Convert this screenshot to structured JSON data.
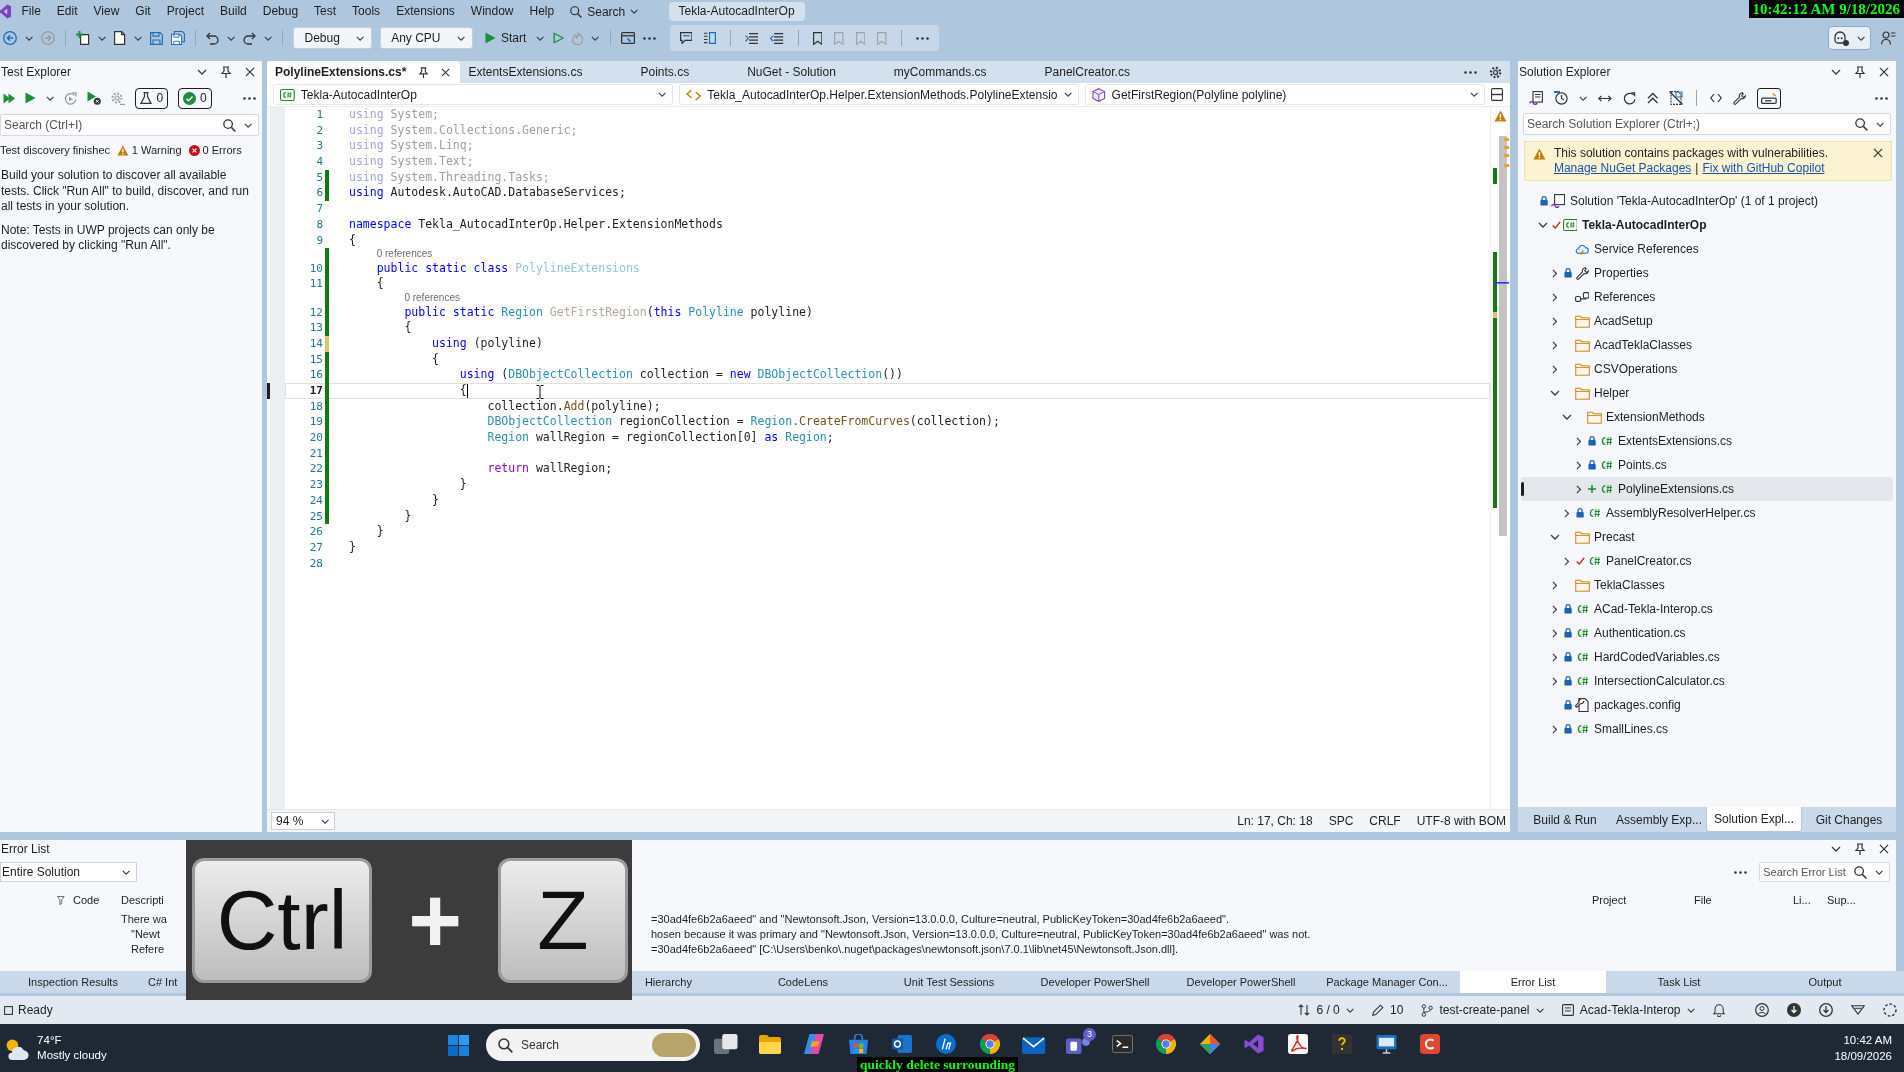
{
  "menu_bar": {
    "items": [
      "File",
      "Edit",
      "View",
      "Git",
      "Project",
      "Build",
      "Debug",
      "Test",
      "Tools",
      "Extensions",
      "Window",
      "Help"
    ],
    "search": "Search",
    "title": "Tekla-AutocadInterOp"
  },
  "clock_overlay": "10:42:12 AM 9/18/2026",
  "toolbar": {
    "configuration": "Debug",
    "platform": "Any CPU",
    "start": "Start"
  },
  "test_explorer": {
    "title": "Test Explorer",
    "test_count": "0",
    "passed_count": "0",
    "search": {
      "placeholder": "Search (Ctrl+I)"
    },
    "status": "Test discovery finishec",
    "warnings": "1 Warning",
    "errors": "0 Errors",
    "messages": [
      "Build your solution to discover all available tests. Click \"Run All\" to build, discover, and run all tests in your solution.",
      "Note: Tests in UWP projects can only be discovered by clicking \"Run All\"."
    ]
  },
  "editor": {
    "tabs": [
      {
        "label": "PolylineExtensions.cs*",
        "selected": true
      },
      {
        "label": "ExtentsExtensions.cs",
        "selected": false
      },
      {
        "label": "Points.cs",
        "selected": false
      },
      {
        "label": "NuGet - Solution",
        "selected": false
      },
      {
        "label": "myCommands.cs",
        "selected": false
      },
      {
        "label": "PanelCreator.cs",
        "selected": false
      }
    ],
    "nav": {
      "project": "Tekla-AutocadInterOp",
      "type": "Tekla_AutocadInterOp.Helper.ExtensionMethods.PolylineExtensio",
      "member": "GetFirstRegion(Polyline polyline)"
    },
    "lines": [
      {
        "number": "1",
        "current": false,
        "tokens": [
          {
            "text": "using",
            "kind": "faded-keyword"
          },
          {
            "text": " System;",
            "kind": "faded"
          }
        ]
      },
      {
        "number": "2",
        "current": false,
        "tokens": [
          {
            "text": "using",
            "kind": "faded-keyword"
          },
          {
            "text": " System.Collections.Generic;",
            "kind": "faded"
          }
        ]
      },
      {
        "number": "3",
        "current": false,
        "tokens": [
          {
            "text": "using",
            "kind": "faded-keyword"
          },
          {
            "text": " System.Linq;",
            "kind": "faded"
          }
        ]
      },
      {
        "number": "4",
        "current": false,
        "tokens": [
          {
            "text": "using",
            "kind": "faded-keyword"
          },
          {
            "text": " System.Text;",
            "kind": "faded"
          }
        ]
      },
      {
        "number": "5",
        "current": false,
        "changed": true,
        "saved": true,
        "tokens": [
          {
            "text": "using",
            "kind": "faded-keyword"
          },
          {
            "text": " System.Threading.Tasks;",
            "kind": "faded"
          }
        ]
      },
      {
        "number": "6",
        "current": false,
        "changed": true,
        "saved": true,
        "tokens": [
          {
            "text": "using",
            "kind": "keyword"
          },
          {
            "text": " Autodesk.AutoCAD.DatabaseServices;",
            "kind": "plain"
          }
        ]
      },
      {
        "number": "7",
        "current": false
      },
      {
        "number": "8",
        "current": false,
        "tokens": [
          {
            "text": "namespace",
            "kind": "keyword"
          },
          {
            "text": " Tekla_AutocadInterOp.Helper.ExtensionMethods",
            "kind": "plain"
          }
        ]
      },
      {
        "number": "9",
        "current": false,
        "tokens": [
          {
            "text": "{",
            "kind": "plain"
          }
        ],
        "children": [
          {
            "number": "10",
            "current": false,
            "changed": true,
            "saved": true,
            "codelens": "0 references",
            "tokens": [
              {
                "text": "public static class ",
                "kind": "keyword"
              },
              {
                "text": "PolylineExtensions",
                "kind": "faded-type"
              }
            ]
          },
          {
            "number": "11",
            "current": false,
            "changed": true,
            "saved": true,
            "tokens": [
              {
                "text": "{",
                "kind": "plain"
              }
            ],
            "children": [
              {
                "number": "12",
                "current": false,
                "changed": true,
                "saved": true,
                "codelens": "0 references",
                "tokens": [
                  {
                    "text": "public static ",
                    "kind": "keyword"
                  },
                  {
                    "text": "Region ",
                    "kind": "type"
                  },
                  {
                    "text": "GetFirstRegion",
                    "kind": "faded-method"
                  },
                  {
                    "text": "(",
                    "kind": "plain"
                  },
                  {
                    "text": "this ",
                    "kind": "keyword"
                  },
                  {
                    "text": "Polyline",
                    "kind": "type"
                  },
                  {
                    "text": " polyline)",
                    "kind": "plain"
                  }
                ]
              },
              {
                "number": "13",
                "current": false,
                "changed": true,
                "saved": true,
                "tokens": [
                  {
                    "text": "{",
                    "kind": "plain"
                  }
                ],
                "children": [
                  {
                    "number": "14",
                    "current": false,
                    "changed": true,
                    "saved": false,
                    "tokens": [
                      {
                        "text": "using",
                        "kind": "keyword"
                      },
                      {
                        "text": " (polyline)",
                        "kind": "plain"
                      }
                    ]
                  },
                  {
                    "number": "15",
                    "current": false,
                    "changed": true,
                    "saved": true,
                    "tokens": [
                      {
                        "text": "{",
                        "kind": "plain"
                      }
                    ],
                    "children": [
                      {
                        "number": "16",
                        "current": false,
                        "changed": true,
                        "saved": true,
                        "tokens": [
                          {
                            "text": "using",
                            "kind": "keyword"
                          },
                          {
                            "text": " (",
                            "kind": "plain"
                          },
                          {
                            "text": "DBObjectCollection",
                            "kind": "type"
                          },
                          {
                            "text": " collection = ",
                            "kind": "plain"
                          },
                          {
                            "text": "new ",
                            "kind": "keyword"
                          },
                          {
                            "text": "DBObjectCollection",
                            "kind": "type"
                          },
                          {
                            "text": "())",
                            "kind": "plain"
                          }
                        ]
                      },
                      {
                        "number": "17",
                        "current": true,
                        "changed": true,
                        "saved": true,
                        "tokens": [
                          {
                            "text": "{",
                            "kind": "plain"
                          }
                        ],
                        "children": [
                          {
                            "number": "18",
                            "current": false,
                            "changed": true,
                            "saved": true,
                            "tokens": [
                              {
                                "text": "collection.",
                                "kind": "plain"
                              },
                              {
                                "text": "Add",
                                "kind": "method"
                              },
                              {
                                "text": "(polyline);",
                                "kind": "plain"
                              }
                            ]
                          },
                          {
                            "number": "19",
                            "current": false,
                            "changed": true,
                            "saved": true,
                            "tokens": [
                              {
                                "text": "DBObjectCollection",
                                "kind": "type"
                              },
                              {
                                "text": " regionCollection = ",
                                "kind": "plain"
                              },
                              {
                                "text": "Region",
                                "kind": "type"
                              },
                              {
                                "text": ".CreateFromCurves",
                                "kind": "method"
                              },
                              {
                                "text": "(collection);",
                                "kind": "plain"
                              }
                            ]
                          },
                          {
                            "number": "20",
                            "current": false,
                            "changed": true,
                            "saved": true,
                            "tokens": [
                              {
                                "text": "Region",
                                "kind": "type"
                              },
                              {
                                "text": " wallRegion = regionCollection[0] ",
                                "kind": "plain"
                              },
                              {
                                "text": "as ",
                                "kind": "keyword"
                              },
                              {
                                "text": "Region",
                                "kind": "type"
                              },
                              {
                                "text": ";",
                                "kind": "plain"
                              }
                            ]
                          },
                          {
                            "number": "21",
                            "current": false,
                            "changed": true,
                            "saved": true
                          },
                          {
                            "number": "22",
                            "current": false,
                            "changed": true,
                            "saved": true,
                            "tokens": [
                              {
                                "text": "return",
                                "kind": "control-keyword"
                              },
                              {
                                "text": " wallRegion;",
                                "kind": "plain"
                              }
                            ]
                          }
                        ]
                      },
                      {
                        "number": "23",
                        "current": false,
                        "changed": true,
                        "saved": true,
                        "tokens": [
                          {
                            "text": "}",
                            "kind": "plain"
                          }
                        ]
                      }
                    ]
                  },
                  {
                    "number": "24",
                    "current": false,
                    "changed": true,
                    "saved": true,
                    "tokens": [
                      {
                        "text": "}",
                        "kind": "plain"
                      }
                    ]
                  }
                ]
              },
              {
                "number": "25",
                "current": false,
                "changed": true,
                "saved": true,
                "tokens": [
                  {
                    "text": "}",
                    "kind": "plain"
                  }
                ]
              }
            ]
          },
          {
            "number": "26",
            "current": false,
            "tokens": [
              {
                "text": "}",
                "kind": "plain"
              }
            ]
          }
        ]
      },
      {
        "number": "27",
        "current": false,
        "tokens": [
          {
            "text": "}",
            "kind": "plain"
          }
        ]
      },
      {
        "number": "28",
        "current": false
      }
    ],
    "zoom": "94 %",
    "position": "Ln: 17, Ch: 18",
    "indentation": "SPC",
    "line_ending": "CRLF",
    "encoding": "UTF-8 with BOM"
  },
  "solution_explorer": {
    "title": "Solution Explorer",
    "toolbar_toggle": {
      "on": true
    },
    "search": {
      "placeholder": "Search Solution Explorer (Ctrl+;)"
    },
    "infobar": {
      "message": "This solution contains packages with vulnerabilities.",
      "links": [
        "Manage NuGet Packages",
        "Fix with GitHub Copilot"
      ],
      "separator": "|"
    },
    "tree": [
      {
        "label": "Solution 'Tekla-AutocadInterOp' (1 of 1 project)",
        "kind": "solution",
        "locked": true,
        "added": false,
        "modified": false,
        "selected": false,
        "children": [
          {
            "label": "Tekla-AutocadInterOp",
            "kind": "project",
            "locked": false,
            "added": false,
            "modified": true,
            "expanded": true,
            "selected": false,
            "children": [
              {
                "label": "Service References",
                "kind": "service-references",
                "locked": false,
                "added": false,
                "modified": false,
                "selected": false
              },
              {
                "label": "Properties",
                "kind": "properties",
                "locked": true,
                "added": false,
                "modified": false,
                "expanded": false,
                "selected": false
              },
              {
                "label": "References",
                "kind": "references",
                "locked": false,
                "added": false,
                "modified": false,
                "expanded": false,
                "selected": false
              },
              {
                "label": "AcadSetup",
                "kind": "folder",
                "locked": false,
                "added": false,
                "modified": false,
                "expanded": false,
                "selected": false
              },
              {
                "label": "AcadTeklaClasses",
                "kind": "folder",
                "locked": false,
                "added": false,
                "modified": false,
                "expanded": false,
                "selected": false
              },
              {
                "label": "CSVOperations",
                "kind": "folder",
                "locked": false,
                "added": false,
                "modified": false,
                "expanded": false,
                "selected": false
              },
              {
                "label": "Helper",
                "kind": "folder",
                "locked": false,
                "added": false,
                "modified": false,
                "expanded": true,
                "selected": false,
                "children": [
                  {
                    "label": "ExtensionMethods",
                    "kind": "folder",
                    "locked": false,
                    "added": false,
                    "modified": false,
                    "expanded": true,
                    "selected": false,
                    "children": [
                      {
                        "label": "ExtentsExtensions.cs",
                        "kind": "csharp",
                        "locked": true,
                        "added": false,
                        "modified": false,
                        "expanded": false,
                        "selected": false
                      },
                      {
                        "label": "Points.cs",
                        "kind": "csharp",
                        "locked": true,
                        "added": false,
                        "modified": false,
                        "expanded": false,
                        "selected": false
                      },
                      {
                        "label": "PolylineExtensions.cs",
                        "kind": "csharp",
                        "locked": false,
                        "added": true,
                        "modified": false,
                        "expanded": false,
                        "selected": true
                      }
                    ]
                  },
                  {
                    "label": "AssemblyResolverHelper.cs",
                    "kind": "csharp",
                    "locked": true,
                    "added": false,
                    "modified": false,
                    "expanded": false,
                    "selected": false
                  }
                ]
              },
              {
                "label": "Precast",
                "kind": "folder",
                "locked": false,
                "added": false,
                "modified": false,
                "expanded": true,
                "selected": false,
                "children": [
                  {
                    "label": "PanelCreator.cs",
                    "kind": "csharp",
                    "locked": false,
                    "added": false,
                    "modified": true,
                    "expanded": false,
                    "selected": false
                  }
                ]
              },
              {
                "label": "TeklaClasses",
                "kind": "folder",
                "locked": false,
                "added": false,
                "modified": false,
                "expanded": false,
                "selected": false
              },
              {
                "label": "ACad-Tekla-Interop.cs",
                "kind": "csharp",
                "locked": true,
                "added": false,
                "modified": false,
                "expanded": false,
                "selected": false
              },
              {
                "label": "Authentication.cs",
                "kind": "csharp",
                "locked": true,
                "added": false,
                "modified": false,
                "expanded": false,
                "selected": false
              },
              {
                "label": "HardCodedVariables.cs",
                "kind": "csharp",
                "locked": true,
                "added": false,
                "modified": false,
                "expanded": false,
                "selected": false
              },
              {
                "label": "IntersectionCalculator.cs",
                "kind": "csharp",
                "locked": true,
                "added": false,
                "modified": false,
                "expanded": false,
                "selected": false
              },
              {
                "label": "packages.config",
                "kind": "config",
                "locked": true,
                "added": false,
                "modified": false,
                "selected": false
              },
              {
                "label": "SmallLines.cs",
                "kind": "csharp",
                "locked": true,
                "added": false,
                "modified": false,
                "expanded": false,
                "selected": false
              }
            ]
          }
        ]
      }
    ],
    "tabs": [
      {
        "label": "Build & Run",
        "selected": false
      },
      {
        "label": "Assembly Exp...",
        "selected": false
      },
      {
        "label": "Solution Expl...",
        "selected": true
      },
      {
        "label": "Git Changes",
        "selected": false
      }
    ]
  },
  "error_list": {
    "title": "Error List",
    "scope": "Entire Solution",
    "search": {
      "placeholder": "Search Error List"
    },
    "columns": [
      "Code",
      "Descripti",
      "Project",
      "File",
      "Li...",
      "Sup..."
    ],
    "message_lines": [
      {
        "start": "There wa",
        "end": "=30ad4fe6b2a6aeed\" and \"Newtonsoft.Json, Version=13.0.0.0, Culture=neutral, PublicKeyToken=30ad4fe6b2a6aeed\"."
      },
      {
        "start": "\"Newt",
        "end": "hosen because it was primary and \"Newtonsoft.Json, Version=13.0.0.0, Culture=neutral, PublicKeyToken=30ad4fe6b2a6aeed\" was not."
      },
      {
        "start": "Refere",
        "end": "=30ad4fe6b2a6aeed\" [C:\\Users\\benko\\.nuget\\packages\\newtonsoft.json\\7.0.1\\lib\\net45\\Newtonsoft.Json.dll]."
      }
    ]
  },
  "tool_tabs": [
    {
      "label": "Inspection Results",
      "selected": false
    },
    {
      "label": "C# Int",
      "selected": false
    },
    {
      "label": "Hierarchy",
      "selected": false
    },
    {
      "label": "CodeLens",
      "selected": false
    },
    {
      "label": "Unit Test Sessions",
      "selected": false
    },
    {
      "label": "Developer PowerShell",
      "selected": false
    },
    {
      "label": "Developer PowerShell",
      "selected": false
    },
    {
      "label": "Package Manager Con...",
      "selected": false
    },
    {
      "label": "Error List",
      "selected": true
    },
    {
      "label": "Task List",
      "selected": false
    },
    {
      "label": "Output",
      "selected": false
    }
  ],
  "status_bar": {
    "state": "Ready",
    "sync": "6 / 0",
    "changes": "10",
    "branch": "test-create-panel",
    "repository": "Acad-Tekla-Interop"
  },
  "taskbar": {
    "temperature": "74°F",
    "weather": "Mostly cloudy",
    "search": {
      "placeholder": "Search"
    },
    "badge": "3",
    "time": "10:42 AM",
    "date": "18/09/2026"
  },
  "keystroke_overlay": {
    "keys": [
      "Ctrl",
      "Z"
    ],
    "separator": "+"
  },
  "caption": "quickly delete surrounding"
}
